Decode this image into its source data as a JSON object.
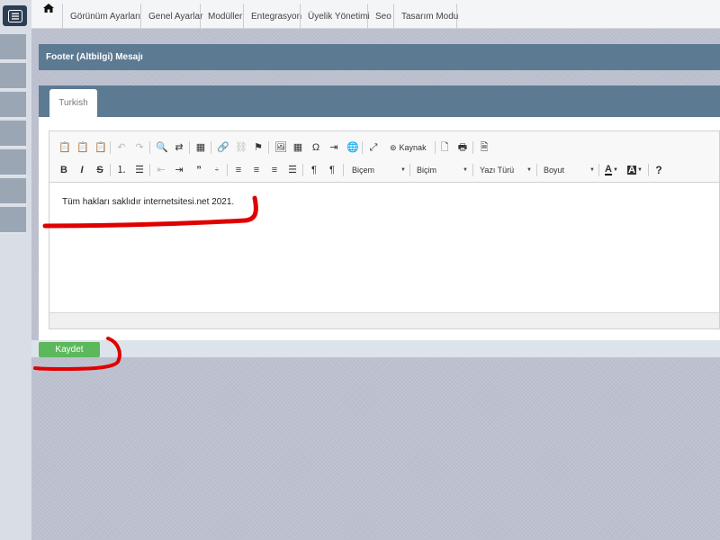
{
  "nav": {
    "items": [
      "Görünüm Ayarları",
      "Genel Ayarlar",
      "Modüller",
      "Entegrasyon",
      "Üyelik Yönetimi",
      "Seo",
      "Tasarım Modu"
    ]
  },
  "panel": {
    "title": "Footer (Altbilgi) Mesajı"
  },
  "tab": {
    "label": "Turkish"
  },
  "toolbar": {
    "source_label": "Kaynak",
    "styles_label": "Biçem",
    "format_label": "Biçim",
    "font_label": "Yazı Türü",
    "size_label": "Boyut"
  },
  "editor": {
    "content": "Tüm hakları saklıdır internetsitesi.net 2021."
  },
  "save": {
    "label": "Kaydet"
  },
  "colors": {
    "accent": "#5d7a93",
    "save": "#5cb85c",
    "annotation": "#e00000"
  }
}
